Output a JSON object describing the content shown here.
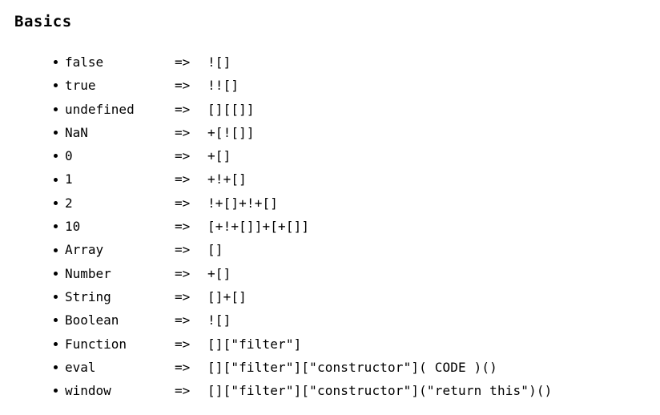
{
  "heading": "Basics",
  "arrow_glyph": "=>",
  "bullet_glyph": "bullet-dot",
  "colors": {
    "background": "#ffffff",
    "text": "#000000"
  },
  "rows": [
    {
      "name": "false",
      "arrow": "=>",
      "value": "![]"
    },
    {
      "name": "true",
      "arrow": "=>",
      "value": "!![]"
    },
    {
      "name": "undefined",
      "arrow": "=>",
      "value": "[][[]]"
    },
    {
      "name": "NaN",
      "arrow": "=>",
      "value": "+[![]]"
    },
    {
      "name": "0",
      "arrow": "=>",
      "value": "+[]"
    },
    {
      "name": "1",
      "arrow": "=>",
      "value": "+!+[]"
    },
    {
      "name": "2",
      "arrow": "=>",
      "value": "!+[]+!+[]"
    },
    {
      "name": "10",
      "arrow": "=>",
      "value": "[+!+[]]+[+[]]"
    },
    {
      "name": "Array",
      "arrow": "=>",
      "value": "[]"
    },
    {
      "name": "Number",
      "arrow": "=>",
      "value": "+[]"
    },
    {
      "name": "String",
      "arrow": "=>",
      "value": "[]+[]"
    },
    {
      "name": "Boolean",
      "arrow": "=>",
      "value": "![]"
    },
    {
      "name": "Function",
      "arrow": "=>",
      "value": "[][\"filter\"]"
    },
    {
      "name": "eval",
      "arrow": "=>",
      "value": "[][\"filter\"][\"constructor\"]( CODE )()"
    },
    {
      "name": "window",
      "arrow": "=>",
      "value": "[][\"filter\"][\"constructor\"](\"return this\")()"
    }
  ]
}
